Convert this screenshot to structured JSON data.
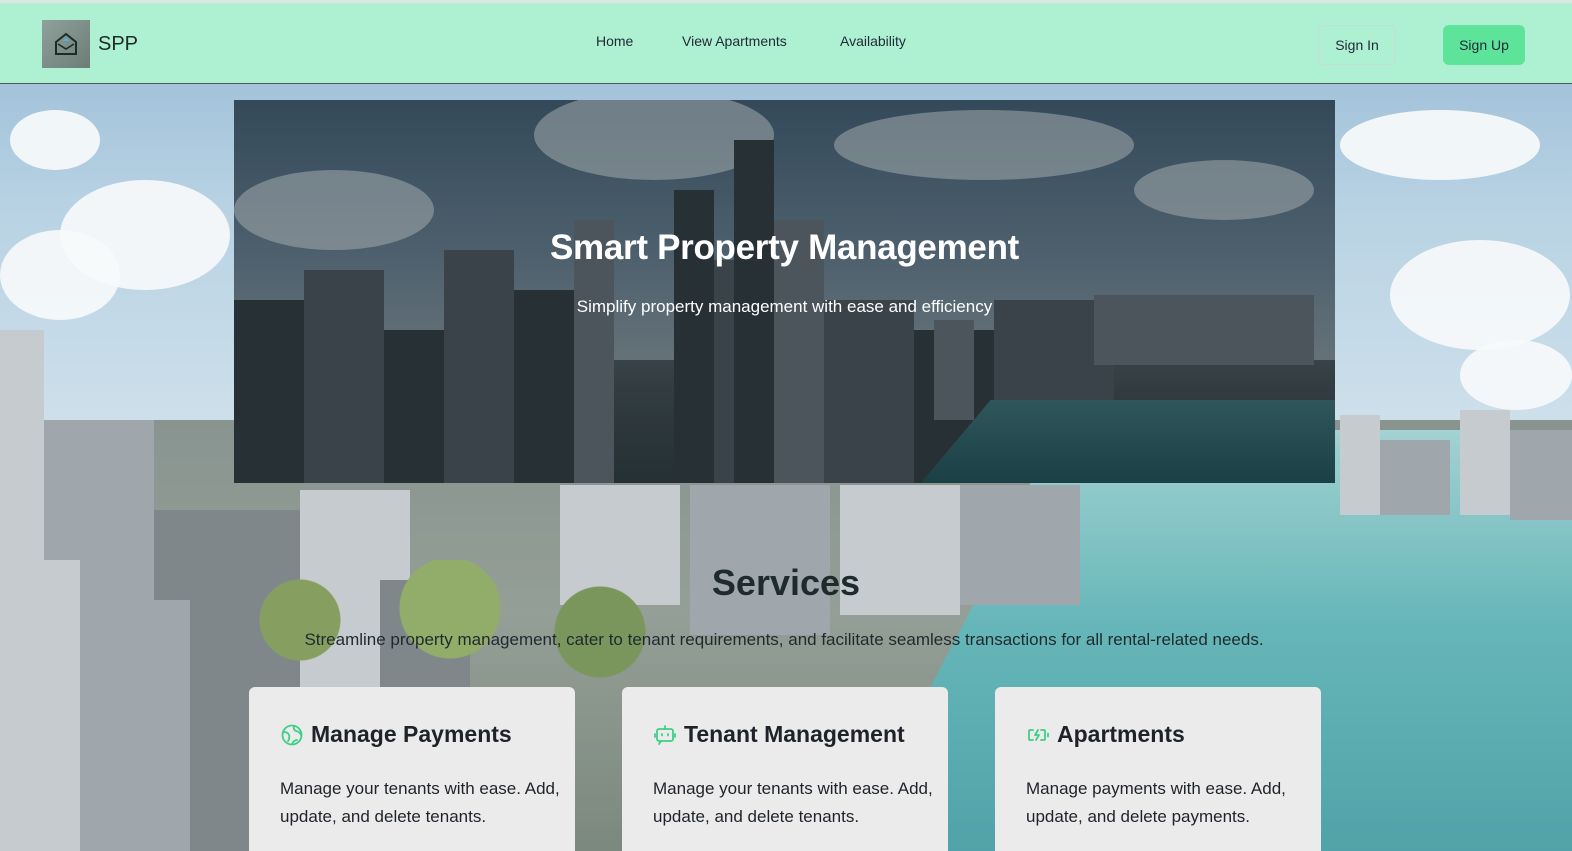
{
  "brand": {
    "name": "SPP",
    "logo_icon": "house-envelope-icon"
  },
  "nav": {
    "links": [
      "Home",
      "View Apartments",
      "Availability"
    ],
    "signin_label": "Sign In",
    "signup_label": "Sign Up"
  },
  "hero": {
    "title": "Smart Property Management",
    "subtitle": "Simplify property management with ease and efficiency"
  },
  "services": {
    "title": "Services",
    "description": "Streamline property management, cater to tenant requirements, and facilitate seamless transactions for all rental-related needs.",
    "cards": [
      {
        "icon": "globe-icon",
        "title": "Manage Payments",
        "text": "Manage your tenants with ease. Add, update, and delete tenants."
      },
      {
        "icon": "chat-bot-icon",
        "title": "Tenant Management",
        "text": "Manage your tenants with ease. Add, update, and delete tenants."
      },
      {
        "icon": "battery-charging-icon",
        "title": "Apartments",
        "text": "Manage payments with ease. Add, update, and delete payments."
      }
    ]
  },
  "colors": {
    "navbar_bg": "#aef0d2",
    "signup_bg": "#5ee49a",
    "icon_accent": "#3fcf86",
    "card_bg": "#ebebeb"
  }
}
